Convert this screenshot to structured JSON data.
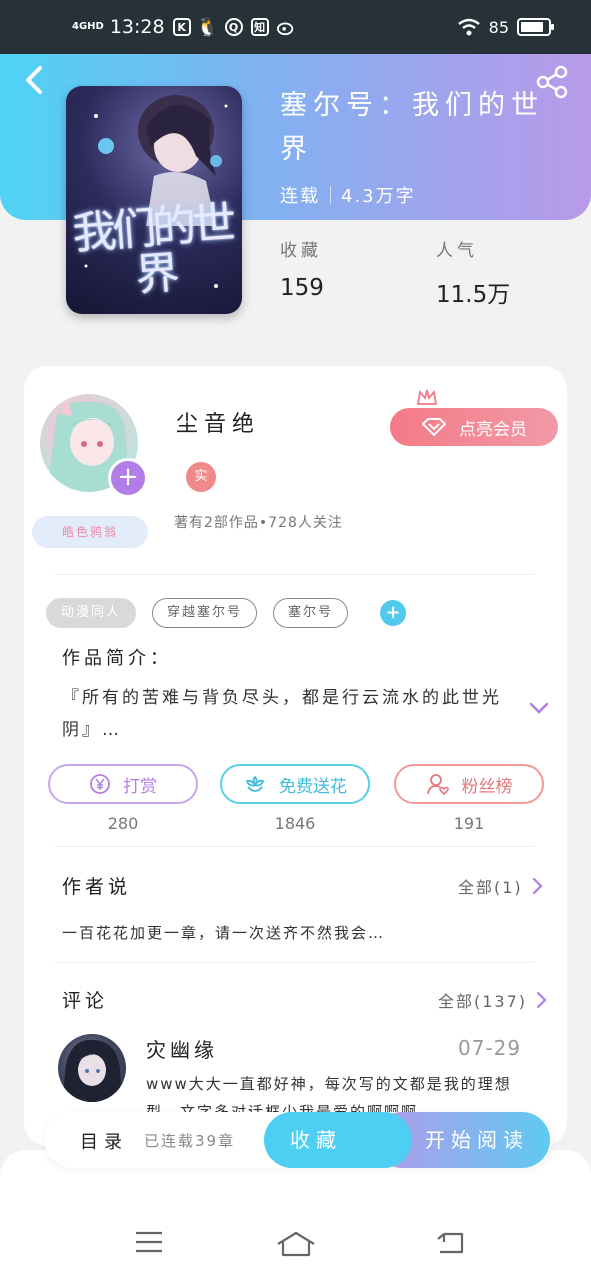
{
  "status_bar": {
    "network": "4GHD",
    "time": "13:28",
    "app_icons": [
      "K",
      "Q",
      "知"
    ],
    "battery": "85",
    "battery_level": 0.85
  },
  "book": {
    "title": "塞尔号：我们的世界",
    "status": "连载",
    "word_count": "4.3万字",
    "cover_text": "我们的世界",
    "stats": [
      {
        "label": "收藏",
        "value": "159"
      },
      {
        "label": "人气",
        "value": "11.5万"
      }
    ]
  },
  "author": {
    "name": "尘音绝",
    "real_badge": "实",
    "subtitle": "著有2部作品•728人关注",
    "avatar_badge": "皓色鸦翁",
    "vip_button": "点亮会员"
  },
  "tags": [
    "动漫同人",
    "穿越塞尔号",
    "塞尔号"
  ],
  "intro": {
    "label": "作品简介：",
    "text": "『所有的苦难与背负尽头，都是行云流水的此世光阴』…"
  },
  "actions": [
    {
      "label": "打赏",
      "count": "280"
    },
    {
      "label": "免费送花",
      "count": "1846"
    },
    {
      "label": "粉丝榜",
      "count": "191"
    }
  ],
  "author_says": {
    "title": "作者说",
    "more": "全部(1)",
    "text": "一百花花加更一章，请一次送齐不然我会…"
  },
  "comments": {
    "title": "评论",
    "more": "全部(137)",
    "item": {
      "name": "灾幽缘",
      "date": "07-29",
      "text": "www大大一直都好神，每次写的文都是我的理想型，文字多对话框少我最爱的啊啊啊…"
    }
  },
  "bottom_bar": {
    "catalog": "目录",
    "status": "已连载39章",
    "collect": "收藏",
    "read": "开始阅读"
  },
  "colors": {
    "header_gradient_start": "#4fd3f5",
    "header_gradient_end": "#b99ae9",
    "vip": "#f47a86",
    "reward": "#b580e3",
    "flower": "#3fbcde",
    "fans": "#e5787b"
  }
}
